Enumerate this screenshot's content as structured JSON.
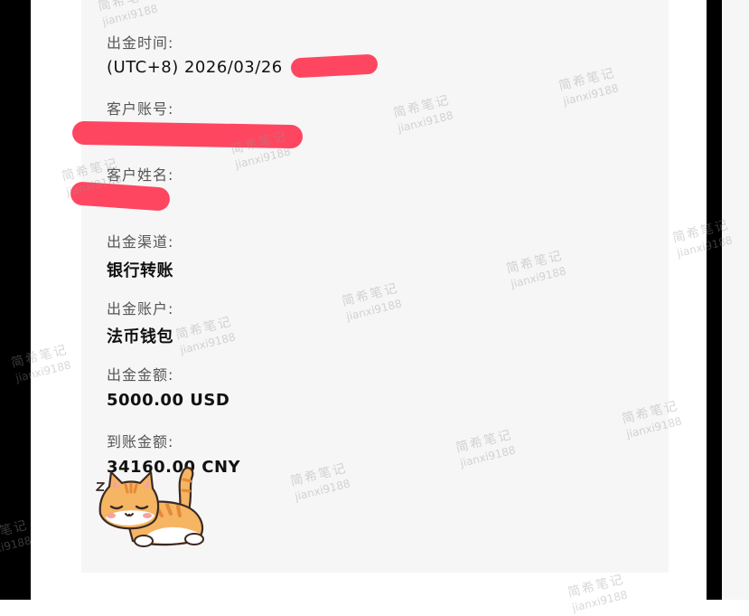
{
  "fields": [
    {
      "label": "出金时间:",
      "value": "(UTC+8) 2026/03/26"
    },
    {
      "label": "客户账号:",
      "value": ""
    },
    {
      "label": "客户姓名:",
      "value": ""
    },
    {
      "label": "出金渠道:",
      "value": "银行转账"
    },
    {
      "label": "出金账户:",
      "value": "法币钱包"
    },
    {
      "label": "出金金额:",
      "value": "5000.00 USD"
    },
    {
      "label": "到账金额:",
      "value": "34160.00 CNY"
    }
  ],
  "watermark": {
    "line1": "简希笔记",
    "line2": "jianxi9188"
  },
  "colors": {
    "redaction": "#ff2e4c",
    "card": "#f6f6f6"
  },
  "icons": [
    "sleeping-cat-sticker-icon"
  ]
}
